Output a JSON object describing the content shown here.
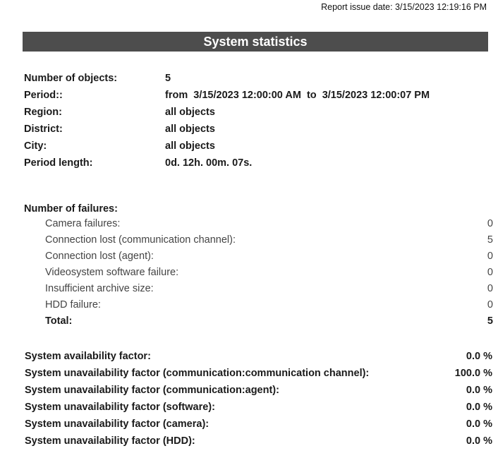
{
  "header": {
    "issue_date": "Report issue date: 3/15/2023 12:19:16 PM",
    "title": "System statistics"
  },
  "info": [
    {
      "label": "Number of objects:",
      "value": "5"
    },
    {
      "label": "Period::",
      "value": "from  3/15/2023 12:00:00 AM  to  3/15/2023 12:00:07 PM"
    },
    {
      "label": "Region:",
      "value": "all objects"
    },
    {
      "label": "District:",
      "value": "all objects"
    },
    {
      "label": "City:",
      "value": "all objects"
    },
    {
      "label": "Period length:",
      "value": "0d. 12h. 00m. 07s."
    }
  ],
  "failures": {
    "heading": "Number of failures:",
    "items": [
      {
        "label": "Camera failures:",
        "value": "0"
      },
      {
        "label": "Connection lost (communication channel):",
        "value": "5"
      },
      {
        "label": "Connection lost (agent):",
        "value": "0"
      },
      {
        "label": "Videosystem software failure:",
        "value": "0"
      },
      {
        "label": "Insufficient archive size:",
        "value": "0"
      },
      {
        "label": "HDD failure:",
        "value": "0"
      }
    ],
    "total_label": "Total:",
    "total_value": "5"
  },
  "factors": [
    {
      "label": "System availability factor:",
      "value": "0.0 %"
    },
    {
      "label": "System unavailability factor (communication:communication channel):",
      "value": "100.0 %"
    },
    {
      "label": "System unavailability factor (communication:agent):",
      "value": "0.0 %"
    },
    {
      "label": "System unavailability factor (software):",
      "value": "0.0 %"
    },
    {
      "label": "System unavailability factor (camera):",
      "value": "0.0 %"
    },
    {
      "label": "System unavailability factor (HDD):",
      "value": "0.0 %"
    }
  ]
}
